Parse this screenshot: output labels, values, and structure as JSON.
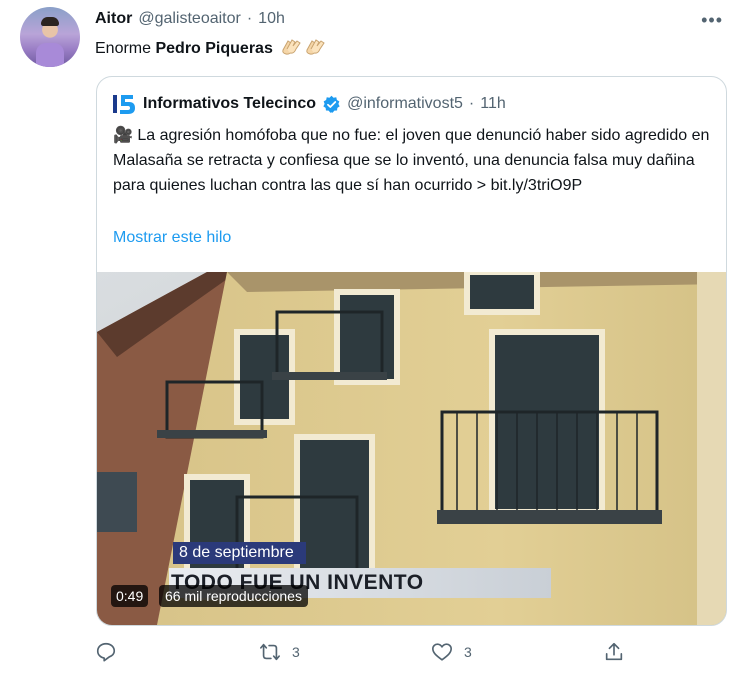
{
  "tweet": {
    "author_name": "Aitor",
    "author_handle": "@galisteoaitor",
    "separator": "·",
    "time": "10h",
    "more_icon": "more-horizontal-icon",
    "text_prefix": "Enorme ",
    "text_bold": "Pedro Piqueras",
    "emoji": [
      "clapping-hands",
      "clapping-hands"
    ]
  },
  "quote": {
    "author_name": "Informativos Telecinco",
    "author_handle": "@informativost5",
    "separator": "·",
    "time": "11h",
    "verified": true,
    "text": "🎥 La agresión homófoba que no fue: el joven que denunció haber sido agredido en Malasaña se retracta y confiesa que se lo inventó, una denuncia falsa muy dañina para quienes luchan contra las que sí han ocurrido > bit.ly/3triO9P",
    "show_thread": "Mostrar este hilo",
    "video": {
      "date_banner": "8 de septiembre",
      "headline": "TODO FUE UN INVENTO",
      "duration": "0:49",
      "views": "66 mil reproducciones"
    }
  },
  "actions": {
    "reply_count": "",
    "retweet_count": "3",
    "like_count": "3",
    "share_count": ""
  },
  "colors": {
    "accent": "#1d9bf0",
    "muted": "#536471",
    "border": "#cfd9de"
  }
}
